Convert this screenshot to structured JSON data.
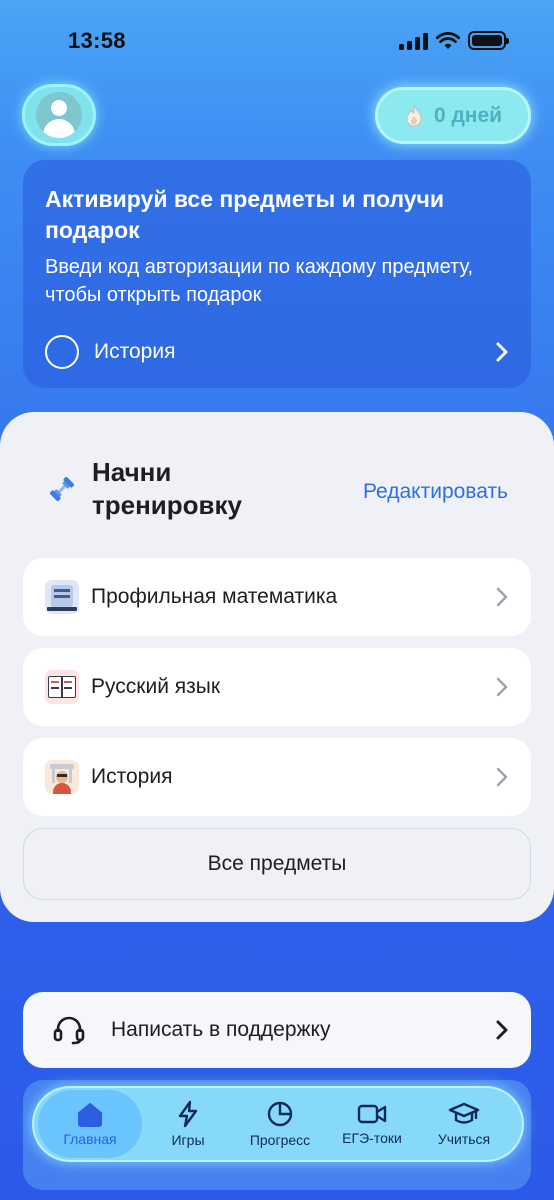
{
  "status_bar": {
    "time": "13:58"
  },
  "header": {
    "streak_label": "0 дней"
  },
  "promo": {
    "title": "Активируй все предметы и получи подарок",
    "text": "Введи код авторизации по каждому предмету, чтобы открыть подарок",
    "subject": "История"
  },
  "training": {
    "title_line1": "Начни",
    "title_line2": "тренировку",
    "edit_label": "Редактировать",
    "subjects": [
      {
        "label": "Профильная математика",
        "icon": "math-icon"
      },
      {
        "label": "Русский язык",
        "icon": "russian-book-icon"
      },
      {
        "label": "История",
        "icon": "history-icon"
      }
    ],
    "all_subjects_label": "Все предметы"
  },
  "support": {
    "label": "Написать в поддержку"
  },
  "bottom_nav": {
    "items": [
      {
        "label": "Главная",
        "icon": "home-icon",
        "active": true
      },
      {
        "label": "Игры",
        "icon": "lightning-icon",
        "active": false
      },
      {
        "label": "Прогресс",
        "icon": "pie-chart-icon",
        "active": false
      },
      {
        "label": "ЕГЭ-токи",
        "icon": "video-camera-icon",
        "active": false
      },
      {
        "label": "Учиться",
        "icon": "graduation-cap-icon",
        "active": false
      }
    ]
  },
  "colors": {
    "accent": "#2d6fe6",
    "background_top": "#4aa6f5",
    "background_bottom": "#2b5ae8",
    "card": "#eff1f6",
    "highlight": "#8ce9ef"
  }
}
